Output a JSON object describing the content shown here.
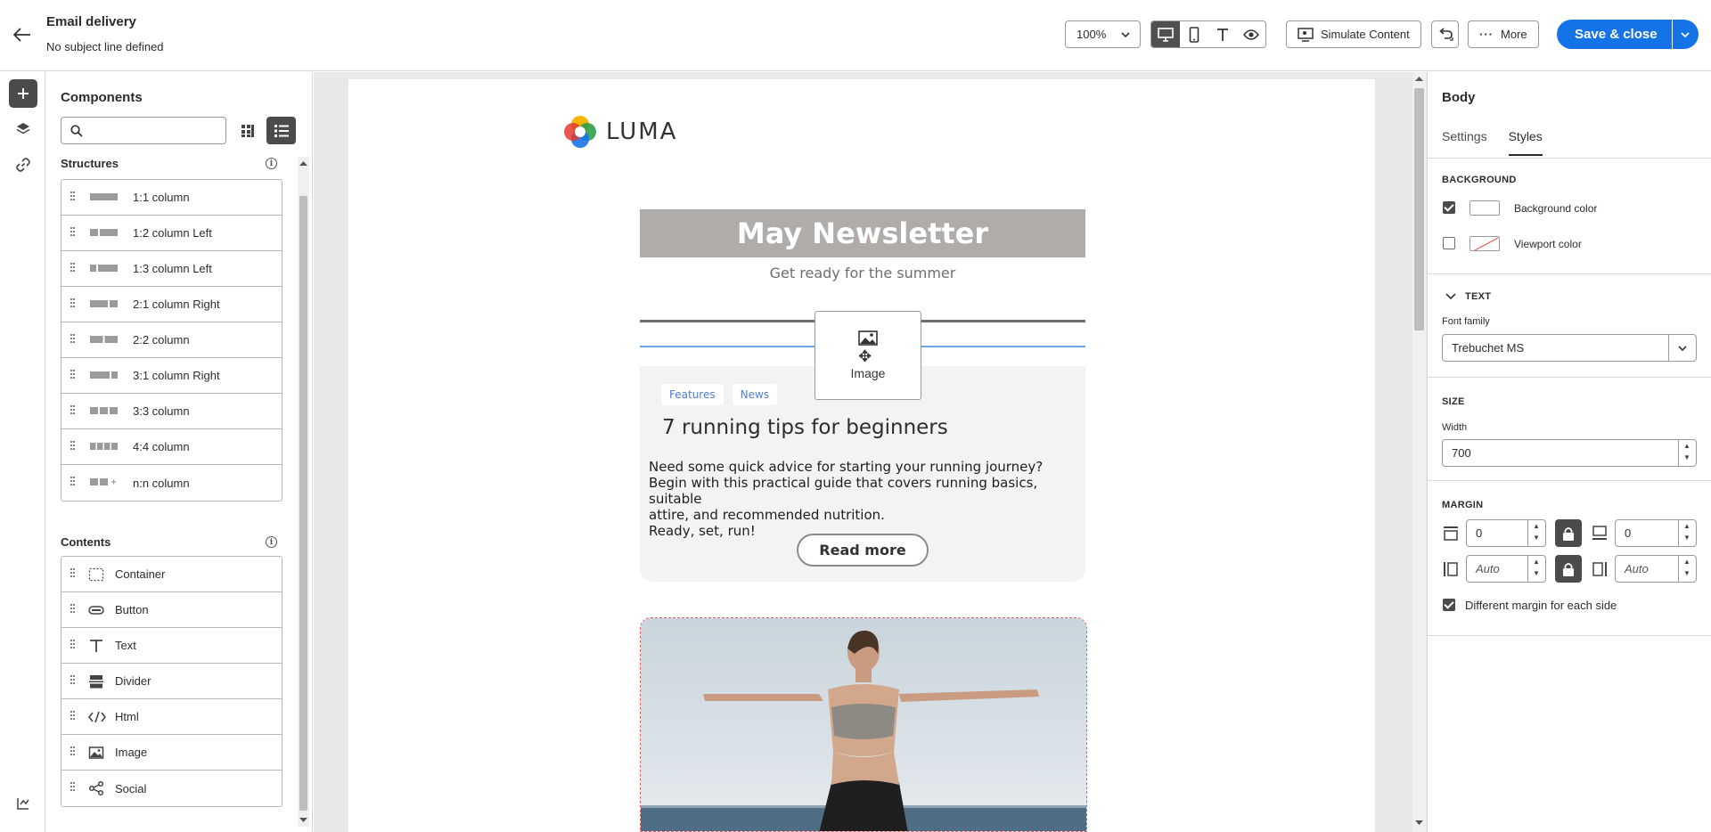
{
  "header": {
    "title": "Email delivery",
    "subtitle": "No subject line defined",
    "zoom": "100%",
    "simulate_label": "Simulate Content",
    "more_label": "More",
    "save_label": "Save & close"
  },
  "components": {
    "title": "Components",
    "search_placeholder": "",
    "structures_title": "Structures",
    "structures": [
      "1:1 column",
      "1:2 column Left",
      "1:3 column Left",
      "2:1 column Right",
      "2:2 column",
      "3:1 column Right",
      "3:3 column",
      "4:4 column",
      "n:n column"
    ],
    "contents_title": "Contents",
    "contents": [
      "Container",
      "Button",
      "Text",
      "Divider",
      "Html",
      "Image",
      "Social"
    ]
  },
  "email": {
    "brand": "LUMA",
    "headline": "May Newsletter",
    "subheadline": "Get ready for the summer",
    "drag_label": "Image",
    "tags": [
      "Features",
      "News"
    ],
    "article_title": "7 running tips for beginners",
    "article_lines": [
      "Need some quick advice for starting your running journey?",
      "Begin with this practical guide that covers running basics, suitable",
      "attire, and recommended nutrition.",
      "Ready, set, run!"
    ],
    "read_more": "Read more"
  },
  "right_panel": {
    "title": "Body",
    "tabs": [
      "Settings",
      "Styles"
    ],
    "active_tab": "Styles",
    "background_label": "BACKGROUND",
    "background_color_label": "Background color",
    "viewport_color_label": "Viewport color",
    "text_label": "TEXT",
    "font_family_label": "Font family",
    "font_family_value": "Trebuchet MS",
    "size_label": "SIZE",
    "width_label": "Width",
    "width_value": "700",
    "margin_label": "MARGIN",
    "margin_top": "0",
    "margin_bottom": "0",
    "margin_left": "Auto",
    "margin_right": "Auto",
    "diff_margin_label": "Different margin for each side",
    "background_color_checked": true,
    "viewport_color_checked": false,
    "diff_margin_checked": true
  },
  "colors": {
    "accent": "#1473e6",
    "header_band": "#b0aca9",
    "tag_text": "#4f7ccf"
  }
}
